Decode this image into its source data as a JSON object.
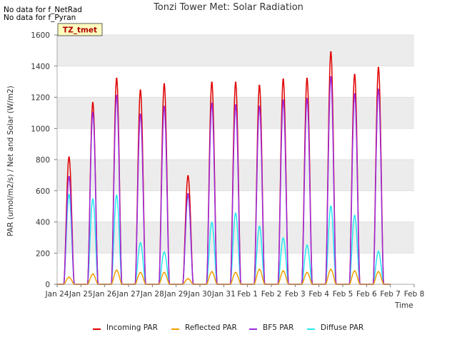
{
  "notes": [
    "No data for f_NetRad",
    "No data for f_Pyran"
  ],
  "chart_data": {
    "type": "line",
    "title": "Tonzi Tower Met: Solar Radiation",
    "xlabel": "Time",
    "ylabel": "PAR (umol/m2/s) / Net and Solar (W/m2)",
    "ylim": [
      0,
      1600
    ],
    "yticks": [
      0,
      200,
      400,
      600,
      800,
      1000,
      1200,
      1400,
      1600
    ],
    "xticks": [
      "Jan 24",
      "Jan 25",
      "Jan 26",
      "Jan 27",
      "Jan 28",
      "Jan 29",
      "Jan 30",
      "Jan 31",
      "Feb 1",
      "Feb 2",
      "Feb 3",
      "Feb 4",
      "Feb 5",
      "Feb 6",
      "Feb 7",
      "Feb 8"
    ],
    "annotation": "TZ_tmet",
    "grid": true,
    "legend_position": "bottom",
    "x": [
      0.5,
      1.5,
      2.5,
      3.5,
      4.5,
      5.5,
      6.5,
      7.5,
      8.5,
      9.5,
      10.5,
      11.5,
      12.5,
      13.5
    ],
    "series": [
      {
        "name": "Incoming PAR",
        "color": "#e00000",
        "values": [
          815,
          1165,
          1320,
          1245,
          1285,
          695,
          1295,
          1295,
          1275,
          1315,
          1320,
          1490,
          1345,
          1390
        ]
      },
      {
        "name": "Reflected PAR",
        "color": "#f0a000",
        "values": [
          45,
          65,
          90,
          75,
          75,
          35,
          80,
          75,
          95,
          85,
          75,
          95,
          85,
          80
        ]
      },
      {
        "name": "BF5 PAR",
        "color": "#9a2be0",
        "values": [
          690,
          1100,
          1210,
          1090,
          1140,
          580,
          1160,
          1150,
          1140,
          1180,
          1190,
          1330,
          1220,
          1250
        ]
      },
      {
        "name": "Diffuse PAR",
        "color": "#22e8f0",
        "values": [
          575,
          545,
          570,
          265,
          205,
          570,
          395,
          455,
          370,
          295,
          250,
          500,
          440,
          210
        ]
      }
    ]
  }
}
